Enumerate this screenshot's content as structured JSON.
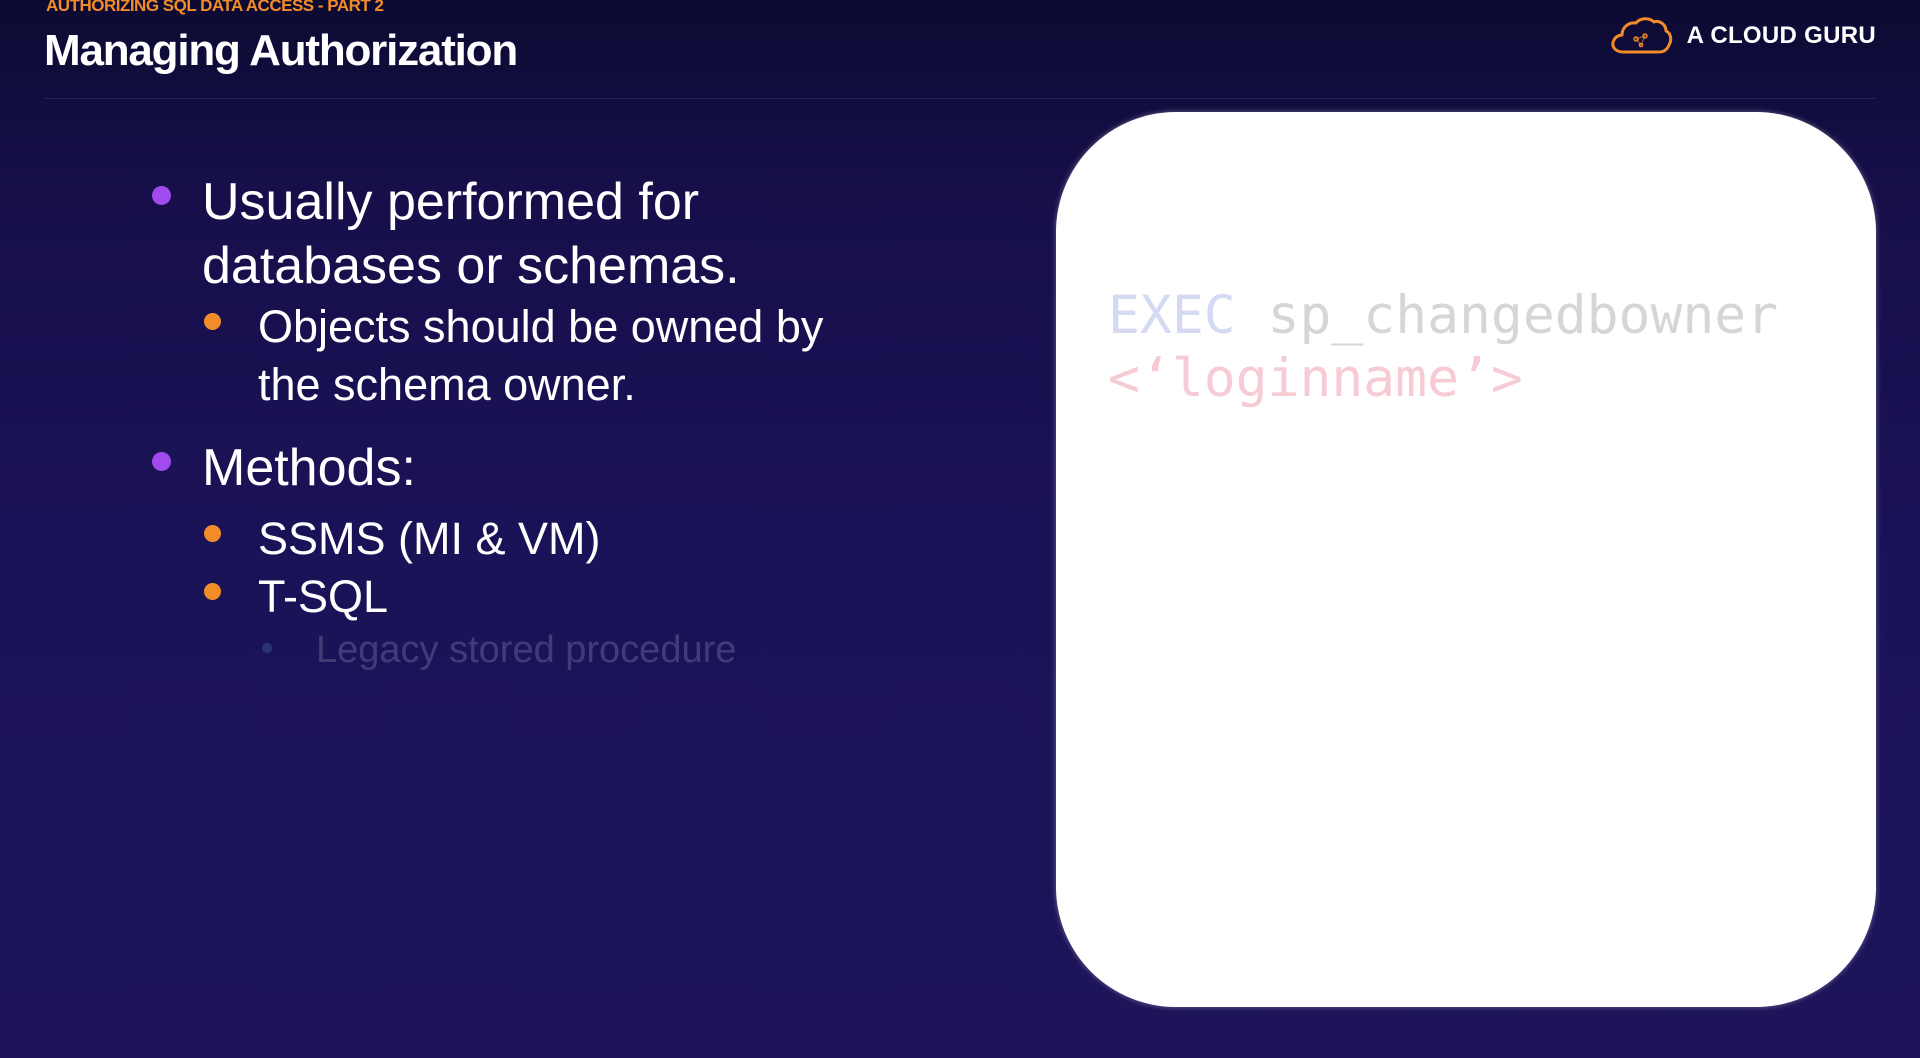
{
  "header": {
    "eyebrow": "AUTHORIZING SQL DATA ACCESS - PART 2",
    "title": "Managing Authorization"
  },
  "logo": {
    "icon": "cloud-icon",
    "text": "A CLOUD GURU",
    "color": "#f28c28"
  },
  "bullets": [
    {
      "text_lines": [
        "Usually performed for",
        "databases or schemas."
      ],
      "sub": [
        {
          "text_lines": [
            "Objects should be owned by",
            "the schema owner."
          ]
        }
      ]
    },
    {
      "text_lines": [
        "Methods:"
      ],
      "sub": [
        {
          "text_lines": [
            "SSMS (MI & VM)"
          ]
        },
        {
          "text_lines": [
            "T-SQL"
          ],
          "sub": [
            {
              "text_lines": [
                "Legacy stored procedure"
              ]
            }
          ]
        }
      ]
    }
  ],
  "code": {
    "keyword": "EXEC",
    "procedure": "sp_changedbowner",
    "parameter": "<‘loginname’>"
  },
  "colors": {
    "accent_orange": "#f28c28",
    "accent_purple": "#a04bf0",
    "background": "#1b1358"
  }
}
